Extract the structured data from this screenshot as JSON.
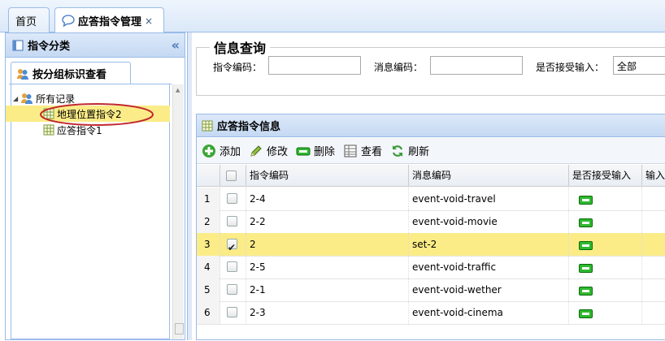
{
  "tabs": [
    {
      "label": "首页"
    },
    {
      "label": "应答指令管理",
      "close": "×"
    }
  ],
  "left_panel": {
    "title": "指令分类",
    "collapse_icon": "«",
    "group_tab": "按分组标识查看",
    "tree": {
      "root": "所有记录",
      "children": [
        "地理位置指令2",
        "应答指令1"
      ],
      "selected_index": 0
    }
  },
  "query": {
    "title": "信息查询",
    "fields": [
      {
        "label": "指令编码：",
        "value": ""
      },
      {
        "label": "消息编码：",
        "value": ""
      },
      {
        "label": "是否接受输入：",
        "value": "全部"
      }
    ]
  },
  "grid": {
    "title": "应答指令信息",
    "toolbar": [
      "添加",
      "修改",
      "删除",
      "查看",
      "刷新"
    ],
    "columns": [
      "指令编码",
      "消息编码",
      "是否接受输入",
      "输入"
    ],
    "rows": [
      {
        "num": "1",
        "checked": false,
        "code": "2-4",
        "msg": "event-void-travel"
      },
      {
        "num": "2",
        "checked": false,
        "code": "2-2",
        "msg": "event-void-movie"
      },
      {
        "num": "3",
        "checked": true,
        "code": "2",
        "msg": "set-2"
      },
      {
        "num": "4",
        "checked": false,
        "code": "2-5",
        "msg": "event-void-traffic"
      },
      {
        "num": "5",
        "checked": false,
        "code": "2-1",
        "msg": "event-void-wether"
      },
      {
        "num": "6",
        "checked": false,
        "code": "2-3",
        "msg": "event-void-cinema"
      }
    ],
    "selected_row": 2
  },
  "colors": {
    "accent_border": "#99bbe8",
    "selected_row": "#fbec88",
    "highlight_circle": "#c0282e"
  }
}
